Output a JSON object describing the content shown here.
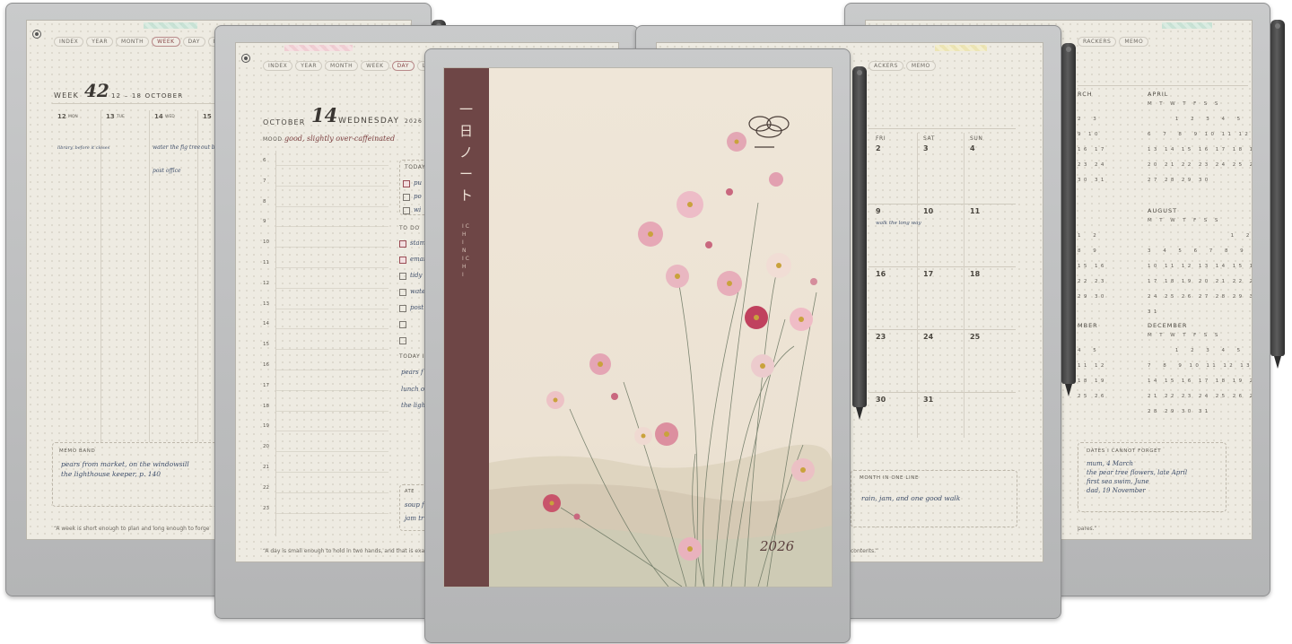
{
  "week_page": {
    "tabs": [
      "INDEX",
      "YEAR",
      "MONTH",
      "WEEK",
      "DAY",
      "LISTS"
    ],
    "active_tab": "WEEK",
    "label": "WEEK",
    "week_number": "42",
    "range": "12 – 18 OCTOBER",
    "days": [
      "12",
      "MON",
      "13",
      "TUE",
      "14",
      "WED",
      "15"
    ],
    "notes": [
      "library, before it closes",
      "water the fig tree",
      "post office",
      "out b"
    ],
    "memo_title": "MEMO BAND",
    "memo_lines": [
      "pears from market, on the windowsill",
      "the lighthouse keeper, p. 140"
    ],
    "quote": "“A week is short enough to plan and long enough to forge"
  },
  "day_page": {
    "tabs": [
      "INDEX",
      "YEAR",
      "MONTH",
      "WEEK",
      "DAY",
      "LISTS"
    ],
    "active_tab": "DAY",
    "month": "OCTOBER",
    "day_number": "14",
    "weekday": "WEDNESDAY",
    "year": "2026",
    "mood_label": "MOOD",
    "mood": "good, slightly over-caffeinated",
    "hours": [
      "6",
      "7",
      "8",
      "9",
      "10",
      "11",
      "12",
      "13",
      "14",
      "15",
      "16",
      "17",
      "18",
      "19",
      "20",
      "21",
      "22",
      "23"
    ],
    "today_label": "TODAY",
    "today_items": [
      "pu",
      "po",
      "wi"
    ],
    "todo_label": "TO DO",
    "todo_items": [
      "stam",
      "emai",
      "tidy",
      "wate",
      "post",
      "",
      ""
    ],
    "today_i_label": "TODAY I",
    "today_i_lines": [
      "pears f",
      "lunch o",
      "the ligh"
    ],
    "eat_label": "ATE",
    "eat_lines": [
      "soup f",
      "jam tr"
    ],
    "quote": "“A day is small enough to hold in two hands, and that is exact"
  },
  "cover": {
    "title_vertical": "一日ノート",
    "subtitle_vertical": "ICHINICHI",
    "year": "2026",
    "spine_color": "#6e4646"
  },
  "month_page": {
    "tabs": [
      "ACKERS",
      "MEMO"
    ],
    "headers": [
      "FRI",
      "SAT",
      "SUN"
    ],
    "weeks": [
      [
        "2",
        "3",
        "4"
      ],
      [
        "9",
        "10",
        "11"
      ],
      [
        "16",
        "17",
        "18"
      ],
      [
        "23",
        "24",
        "25"
      ],
      [
        "30",
        "31",
        ""
      ]
    ],
    "note": "walk the long way",
    "line_title": "MONTH IN ONE LINE",
    "line_text": "rain, jam, and one good walk",
    "quote": "contents.”"
  },
  "year_page": {
    "tabs": [
      "RACKERS",
      "MEMO"
    ],
    "months": [
      {
        "name": "RCH",
        "rows": [
          "",
          "2  3",
          "9 10",
          "16 17",
          "23 24",
          "30 31"
        ]
      },
      {
        "name": "APRIL",
        "rows": [
          "M T W T F S S",
          "      1  2  3  4  5",
          "6  7  8  9 10 11 12",
          "13 14 15 16 17 18 19",
          "20 21 22 23 24 25 26",
          "27 28 29 30"
        ]
      },
      {
        "name": "",
        "rows": [
          "",
          "1  2",
          "8  9",
          "15 16",
          "22 23",
          "29 30"
        ]
      },
      {
        "name": "AUGUST",
        "rows": [
          "M T W T F S S",
          "                  1  2",
          "3  4  5  6  7  8  9",
          "10 11 12 13 14 15 16",
          "17 18 19 20 21 22 23",
          "24 25 26 27 28 29 30",
          "31"
        ]
      },
      {
        "name": "MBER",
        "rows": [
          "",
          "4  5",
          "11 12",
          "18 19",
          "25 26",
          ""
        ]
      },
      {
        "name": "DECEMBER",
        "rows": [
          "M T W T F S S",
          "      1  2  3  4  5  6",
          "7  8  9 10 11 12 13",
          "14 15 16 17 18 19 20",
          "21 22 23 24 25 26 27",
          "28 29 30 31"
        ]
      }
    ],
    "dates_title": "DATES I CANNOT FORGET",
    "dates_lines": [
      "mum, 4 March",
      "the pear tree flowers, late April",
      "first sea swim, June",
      "dad, 19 November"
    ],
    "quote": "pares.”"
  }
}
